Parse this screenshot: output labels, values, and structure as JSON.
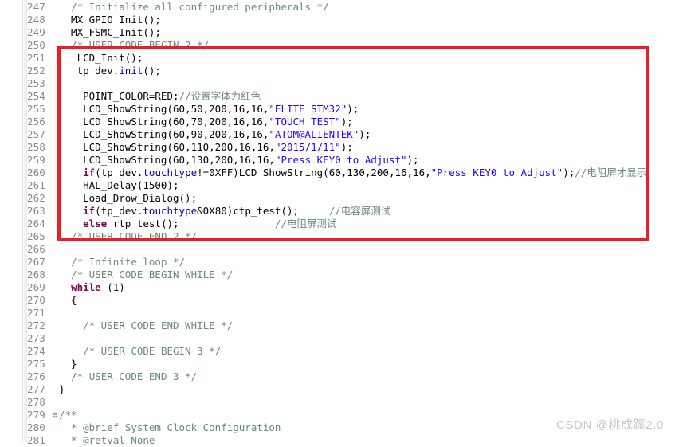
{
  "app": {
    "kind": "code-editor",
    "language": "C",
    "theme": "light"
  },
  "watermark": {
    "text": "CSDN @桃成蹊2.0",
    "color": "#c8c8c8"
  },
  "annotation": {
    "shape": "rectangle",
    "color": "#ee1c25",
    "covers_lines": "250-265"
  },
  "editor": {
    "first_line": 247,
    "last_line": 281,
    "fold_marker_lines": [
      279
    ],
    "lines": [
      {
        "n": "247",
        "fold": "",
        "tokens": [
          {
            "t": "  ",
            "c": "pln"
          },
          {
            "t": "/* Initialize all configured peripherals */",
            "c": "cmt"
          }
        ]
      },
      {
        "n": "248",
        "fold": "",
        "tokens": [
          {
            "t": "  MX_GPIO_Init();",
            "c": "pln"
          }
        ]
      },
      {
        "n": "249",
        "fold": "",
        "tokens": [
          {
            "t": "  MX_FSMC_Init();",
            "c": "pln"
          }
        ]
      },
      {
        "n": "250",
        "fold": "",
        "tokens": [
          {
            "t": "  ",
            "c": "pln"
          },
          {
            "t": "/* USER CODE BEGIN 2 */",
            "c": "cmt"
          }
        ]
      },
      {
        "n": "251",
        "fold": "",
        "tokens": [
          {
            "t": "   LCD_Init();",
            "c": "pln"
          }
        ]
      },
      {
        "n": "252",
        "fold": "",
        "tokens": [
          {
            "t": "   tp_dev.",
            "c": "pln"
          },
          {
            "t": "init",
            "c": "fld"
          },
          {
            "t": "();",
            "c": "pln"
          }
        ]
      },
      {
        "n": "253",
        "fold": "",
        "tokens": []
      },
      {
        "n": "254",
        "fold": "",
        "tokens": [
          {
            "t": "    POINT_COLOR=RED;",
            "c": "pln"
          },
          {
            "t": "//设置字体为红色",
            "c": "cmt"
          }
        ]
      },
      {
        "n": "255",
        "fold": "",
        "tokens": [
          {
            "t": "    LCD_ShowString(60,50,200,16,16,",
            "c": "pln"
          },
          {
            "t": "\"ELITE STM32\"",
            "c": "str"
          },
          {
            "t": ");",
            "c": "pln"
          }
        ]
      },
      {
        "n": "256",
        "fold": "",
        "tokens": [
          {
            "t": "    LCD_ShowString(60,70,200,16,16,",
            "c": "pln"
          },
          {
            "t": "\"TOUCH TEST\"",
            "c": "str"
          },
          {
            "t": ");",
            "c": "pln"
          }
        ]
      },
      {
        "n": "257",
        "fold": "",
        "tokens": [
          {
            "t": "    LCD_ShowString(60,90,200,16,16,",
            "c": "pln"
          },
          {
            "t": "\"ATOM@ALIENTEK\"",
            "c": "str"
          },
          {
            "t": ");",
            "c": "pln"
          }
        ]
      },
      {
        "n": "258",
        "fold": "",
        "tokens": [
          {
            "t": "    LCD_ShowString(60,110,200,16,16,",
            "c": "pln"
          },
          {
            "t": "\"2015/1/11\"",
            "c": "str"
          },
          {
            "t": ");",
            "c": "pln"
          }
        ]
      },
      {
        "n": "259",
        "fold": "",
        "tokens": [
          {
            "t": "    LCD_ShowString(60,130,200,16,16,",
            "c": "pln"
          },
          {
            "t": "\"Press KEY0 to Adjust\"",
            "c": "str"
          },
          {
            "t": ");",
            "c": "pln"
          }
        ]
      },
      {
        "n": "260",
        "fold": "",
        "tokens": [
          {
            "t": "    ",
            "c": "pln"
          },
          {
            "t": "if",
            "c": "kw"
          },
          {
            "t": "(tp_dev.",
            "c": "pln"
          },
          {
            "t": "touchtype",
            "c": "fld"
          },
          {
            "t": "!=0XFF)LCD_ShowString(60,130,200,16,16,",
            "c": "pln"
          },
          {
            "t": "\"Press KEY0 to Adjust\"",
            "c": "str"
          },
          {
            "t": ");",
            "c": "pln"
          },
          {
            "t": "//电阻屏才显示",
            "c": "cmt"
          }
        ]
      },
      {
        "n": "261",
        "fold": "",
        "tokens": [
          {
            "t": "    HAL_Delay(1500);",
            "c": "pln"
          }
        ]
      },
      {
        "n": "262",
        "fold": "",
        "tokens": [
          {
            "t": "    Load_Drow_Dialog();",
            "c": "pln"
          }
        ]
      },
      {
        "n": "263",
        "fold": "",
        "tokens": [
          {
            "t": "    ",
            "c": "pln"
          },
          {
            "t": "if",
            "c": "kw"
          },
          {
            "t": "(tp_dev.",
            "c": "pln"
          },
          {
            "t": "touchtype",
            "c": "fld"
          },
          {
            "t": "&0X80)ctp_test();     ",
            "c": "pln"
          },
          {
            "t": "//电容屏测试",
            "c": "cmt"
          }
        ]
      },
      {
        "n": "264",
        "fold": "",
        "tokens": [
          {
            "t": "    ",
            "c": "pln"
          },
          {
            "t": "else",
            "c": "kw"
          },
          {
            "t": " rtp_test();                ",
            "c": "pln"
          },
          {
            "t": "//电阻屏测试",
            "c": "cmt"
          }
        ]
      },
      {
        "n": "265",
        "fold": "",
        "tokens": [
          {
            "t": "  ",
            "c": "pln"
          },
          {
            "t": "/* USER CODE END 2 */",
            "c": "cmt"
          }
        ]
      },
      {
        "n": "266",
        "fold": "",
        "tokens": []
      },
      {
        "n": "267",
        "fold": "",
        "tokens": [
          {
            "t": "  ",
            "c": "pln"
          },
          {
            "t": "/* Infinite loop */",
            "c": "cmt"
          }
        ]
      },
      {
        "n": "268",
        "fold": "",
        "tokens": [
          {
            "t": "  ",
            "c": "pln"
          },
          {
            "t": "/* USER CODE BEGIN WHILE */",
            "c": "cmt"
          }
        ]
      },
      {
        "n": "269",
        "fold": "",
        "tokens": [
          {
            "t": "  ",
            "c": "pln"
          },
          {
            "t": "while",
            "c": "kw"
          },
          {
            "t": " (1)",
            "c": "pln"
          }
        ]
      },
      {
        "n": "270",
        "fold": "",
        "tokens": [
          {
            "t": "  {",
            "c": "pln"
          }
        ]
      },
      {
        "n": "271",
        "fold": "",
        "tokens": []
      },
      {
        "n": "272",
        "fold": "",
        "tokens": [
          {
            "t": "    ",
            "c": "pln"
          },
          {
            "t": "/* USER CODE END WHILE */",
            "c": "cmt"
          }
        ]
      },
      {
        "n": "273",
        "fold": "",
        "tokens": []
      },
      {
        "n": "274",
        "fold": "",
        "tokens": [
          {
            "t": "    ",
            "c": "pln"
          },
          {
            "t": "/* USER CODE BEGIN 3 */",
            "c": "cmt"
          }
        ]
      },
      {
        "n": "275",
        "fold": "",
        "tokens": [
          {
            "t": "  }",
            "c": "pln"
          }
        ]
      },
      {
        "n": "276",
        "fold": "",
        "tokens": [
          {
            "t": "  ",
            "c": "pln"
          },
          {
            "t": "/* USER CODE END 3 */",
            "c": "cmt"
          }
        ]
      },
      {
        "n": "277",
        "fold": "",
        "tokens": [
          {
            "t": "}",
            "c": "pln"
          }
        ]
      },
      {
        "n": "278",
        "fold": "",
        "tokens": []
      },
      {
        "n": "279",
        "fold": "⊖",
        "tokens": [
          {
            "t": "/**",
            "c": "cmt"
          }
        ]
      },
      {
        "n": "280",
        "fold": "",
        "tokens": [
          {
            "t": "  * @brief System Clock Configuration",
            "c": "cmt"
          }
        ]
      },
      {
        "n": "281",
        "fold": "",
        "tokens": [
          {
            "t": "  * @retval None",
            "c": "cmt"
          }
        ]
      }
    ]
  }
}
